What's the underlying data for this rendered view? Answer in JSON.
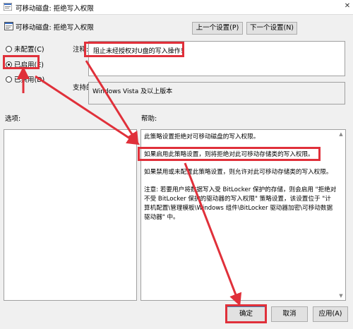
{
  "window": {
    "title": "可移动磁盘: 拒绝写入权限"
  },
  "header": {
    "policy_title": "可移动磁盘: 拒绝写入权限"
  },
  "nav": {
    "prev_label": "上一个设置(P)",
    "next_label": "下一个设置(N)"
  },
  "options": [
    {
      "label": "未配置(C)",
      "checked": false
    },
    {
      "label": "已启用(E)",
      "checked": true
    },
    {
      "label": "已禁用(D)",
      "checked": false
    }
  ],
  "comment": {
    "label": "注释:",
    "value": "阻止未经授权对U盘的写入操作！"
  },
  "supported": {
    "label": "支持的平台:",
    "value": "Windows Vista 及以上版本"
  },
  "options_pane": {
    "label": "选项:"
  },
  "help_pane": {
    "label": "帮助:",
    "paragraphs": [
      "此策略设置拒绝对可移动磁盘的写入权限。",
      "如果启用此策略设置，则将拒绝对此可移动存储类的写入权限。",
      "如果禁用或未配置此策略设置，则允许对此可移动存储类的写入权限。",
      "注意: 若要用户将数据写入受 BitLocker 保护的存储，则会启用 \"拒绝对不受 BitLocker 保护的驱动器的写入权限\" 策略设置，该设置位于 \"计算机配置\\管理模板\\Windows 组件\\BitLocker 驱动器加密\\可移动数据驱动器\" 中。"
    ]
  },
  "footer": {
    "ok_label": "确定",
    "cancel_label": "取消",
    "apply_label": "应用(A)"
  },
  "colors": {
    "annotation": "#e0303a",
    "selection": "#e0303a"
  }
}
